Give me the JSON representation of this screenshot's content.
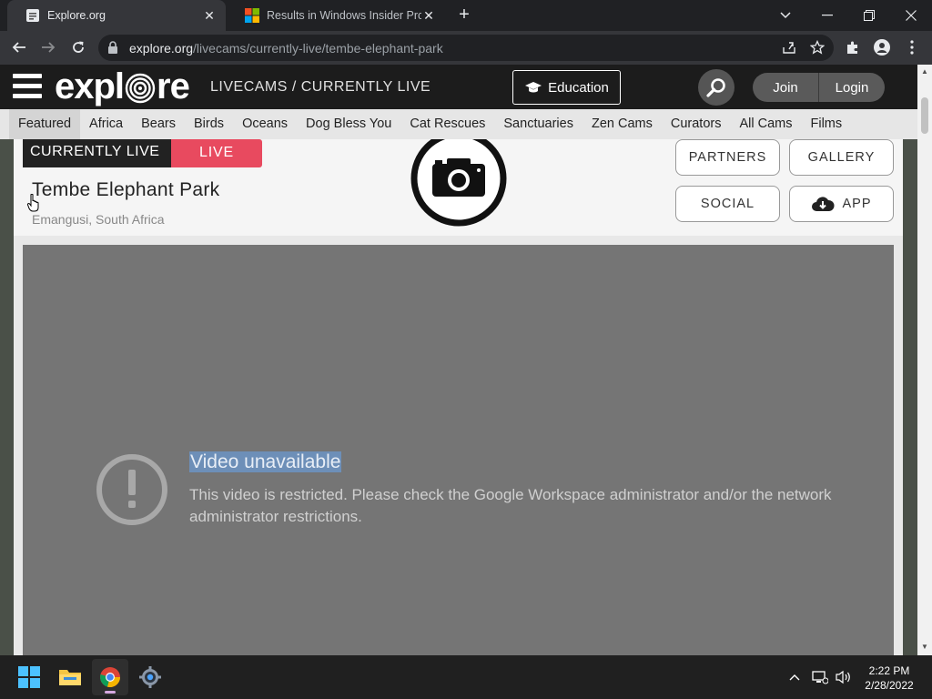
{
  "browser": {
    "tabs": [
      {
        "title": "Explore.org",
        "active": true
      },
      {
        "title": "Results in Windows Insider Progr",
        "active": false
      }
    ],
    "url_host": "explore.org",
    "url_path": "/livecams/currently-live/tembe-elephant-park"
  },
  "site": {
    "logo_text_pre": "expl",
    "logo_text_post": "re",
    "crumb": "LIVECAMS / CURRENTLY LIVE",
    "education_label": "Education",
    "join_label": "Join",
    "login_label": "Login",
    "categories": [
      "Featured",
      "Africa",
      "Bears",
      "Birds",
      "Oceans",
      "Dog Bless You",
      "Cat Rescues",
      "Sanctuaries",
      "Zen Cams",
      "Curators",
      "All Cams",
      "Films"
    ],
    "active_category": "Featured"
  },
  "cam": {
    "badge_label": "CURRENTLY LIVE",
    "live_label": "LIVE",
    "title": "Tembe Elephant Park",
    "location": "Emangusi, South Africa",
    "buttons": {
      "partners": "PARTNERS",
      "gallery": "GALLERY",
      "social": "SOCIAL",
      "app": "APP"
    }
  },
  "video": {
    "error_title": "Video unavailable",
    "error_message": "This video is restricted. Please check the Google Workspace administrator and/or the network administrator restrictions."
  },
  "taskbar": {
    "time": "2:22 PM",
    "date": "2/28/2022"
  },
  "colors": {
    "live_red": "#e84a5f",
    "header_dark": "#1c1c1c",
    "video_gray": "#757575"
  }
}
